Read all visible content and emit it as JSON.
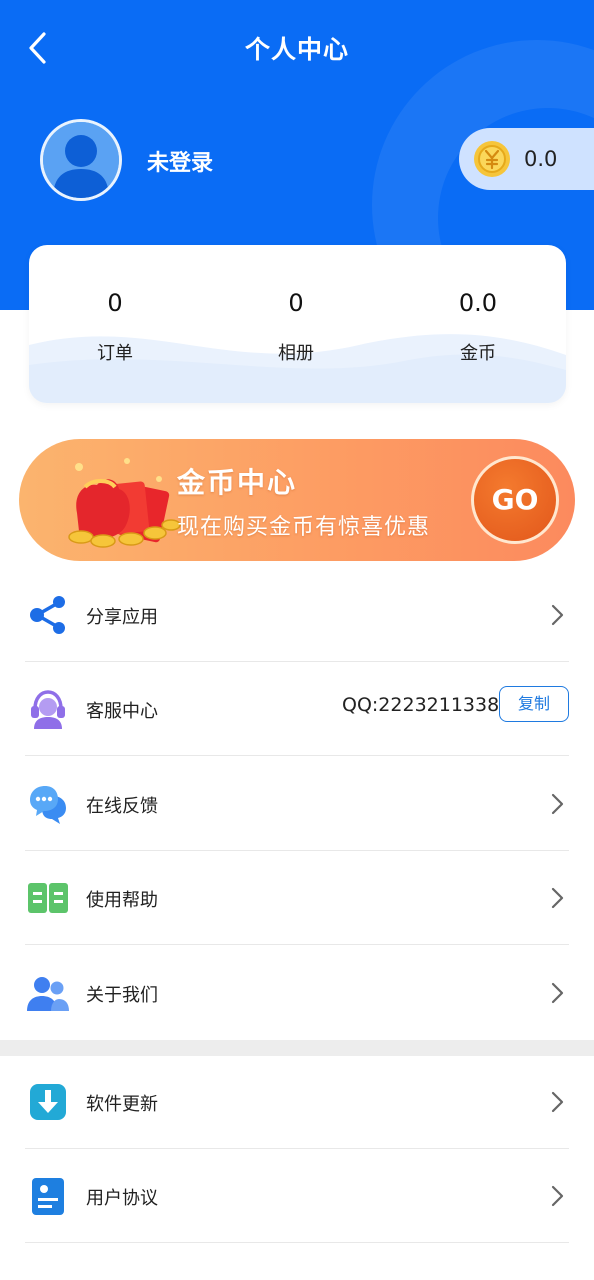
{
  "nav": {
    "title": "个人中心",
    "back_icon": "back-arrow-icon"
  },
  "profile": {
    "username": "未登录",
    "coin_balance": "0.0"
  },
  "stats": [
    {
      "value": "0",
      "label": "订单"
    },
    {
      "value": "0",
      "label": "相册"
    },
    {
      "value": "0.0",
      "label": "金币"
    }
  ],
  "banner": {
    "title": "金币中心",
    "subtitle": "现在购买金币有惊喜优惠",
    "button": "GO"
  },
  "menu": {
    "share": {
      "label": "分享应用",
      "icon": "share-icon"
    },
    "service": {
      "label": "客服中心",
      "icon": "customer-service-icon",
      "qq": "QQ:2223211338",
      "copy": "复制"
    },
    "feedback": {
      "label": "在线反馈",
      "icon": "chat-bubbles-icon"
    },
    "help": {
      "label": "使用帮助",
      "icon": "book-icon"
    },
    "about": {
      "label": "关于我们",
      "icon": "people-icon"
    },
    "update": {
      "label": "软件更新",
      "icon": "download-icon"
    },
    "agreement": {
      "label": "用户协议",
      "icon": "document-icon"
    }
  },
  "colors": {
    "primary": "#0a6cf5",
    "banner_start": "#fbb46e",
    "banner_end": "#fc8a5e",
    "go": "#e2571b"
  }
}
